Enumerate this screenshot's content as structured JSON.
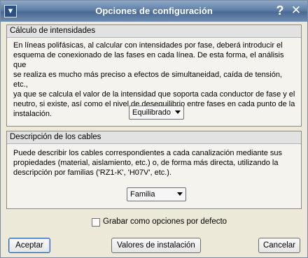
{
  "window": {
    "title": "Opciones de configuración",
    "help_glyph": "?",
    "close_glyph": "✕"
  },
  "intensidades": {
    "header": "Cálculo de intensidades",
    "lines": [
      "En líneas polifásicas, al calcular con intensidades por fase, deberá introducir el",
      "esquema de conexionado de las fases en cada línea. De esta forma, el análisis que",
      "se realiza es mucho más preciso a efectos de simultaneidad, caída de tensión, etc.,",
      "ya que se calcula el valor de la intensidad que soporta cada conductor de fase y el",
      "neutro, si existe, así como el nivel de desequilibrio entre fases en cada punto de la",
      "instalación."
    ],
    "select_value": "Equilibrado"
  },
  "cables": {
    "header": "Descripción de los cables",
    "lines": [
      "Puede describir los cables correspondientes a cada canalización mediante sus",
      "propiedades (material, aislamiento, etc.) o, de forma más directa, utilizando la",
      "descripción por familias ('RZ1-K', 'H07V', etc.)."
    ],
    "select_value": "Familia"
  },
  "save_default": {
    "label": "Grabar como opciones por defecto",
    "checked": false
  },
  "buttons": {
    "accept": "Aceptar",
    "install_values": "Valores de instalación",
    "cancel": "Cancelar"
  }
}
